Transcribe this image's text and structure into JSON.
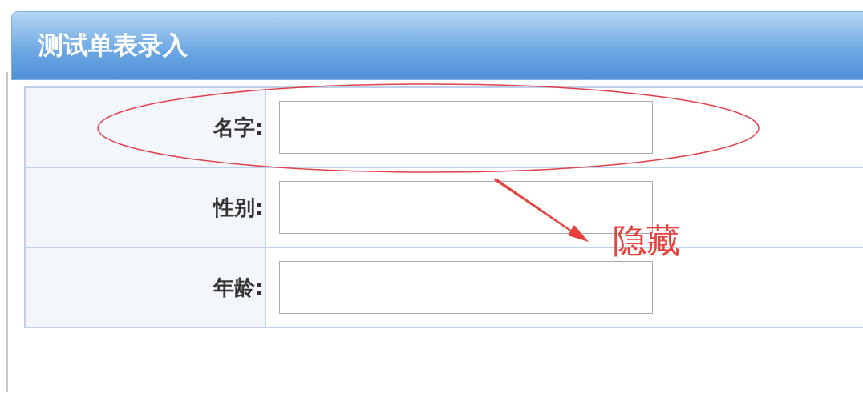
{
  "panel": {
    "title": "测试单表录入"
  },
  "fields": [
    {
      "label": "名字:"
    },
    {
      "label": "性别:"
    },
    {
      "label": "年龄:"
    }
  ],
  "annotation": {
    "text": "隐藏"
  }
}
